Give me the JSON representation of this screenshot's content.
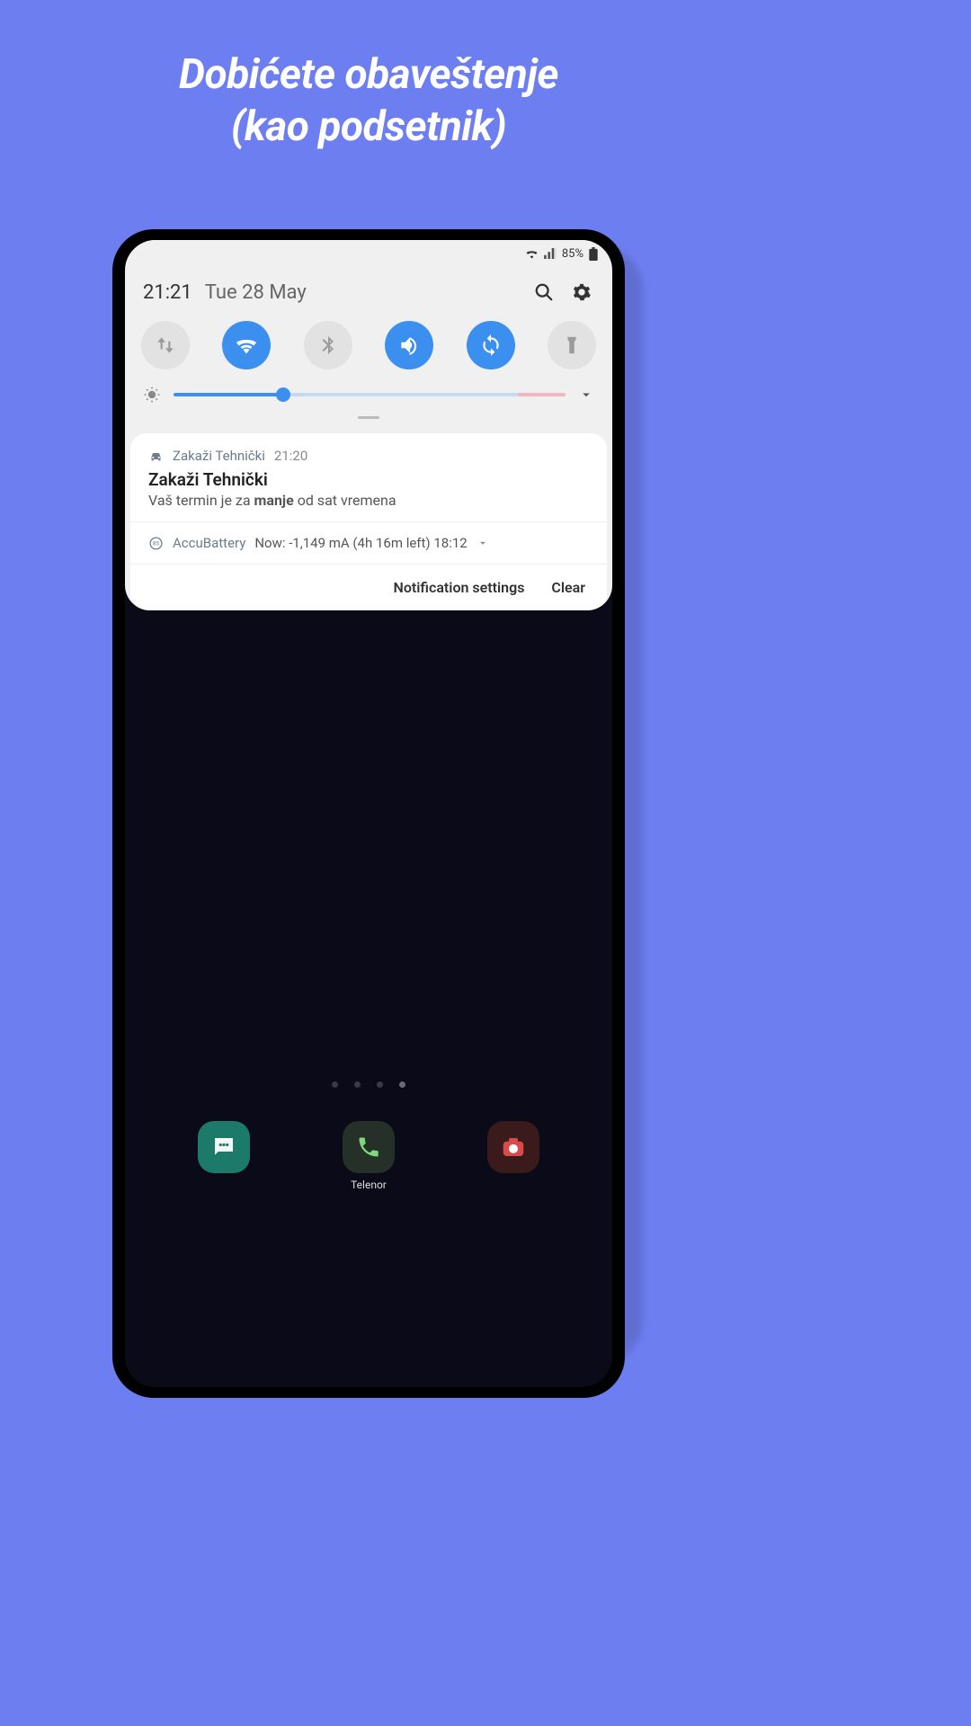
{
  "headline_line1": "Dobićete obaveštenje",
  "headline_line2": "(kao podsetnik)",
  "status": {
    "battery_text": "85%"
  },
  "qs": {
    "time": "21:21",
    "date": "Tue 28 May"
  },
  "notification1": {
    "app_name": "Zakaži Tehnički",
    "time": "21:20",
    "title": "Zakaži Tehnički",
    "body_prefix": "Vaš termin je za ",
    "body_bold": "manje",
    "body_suffix": " od sat vremena"
  },
  "notification2": {
    "app_name": "AccuBattery",
    "details": "Now: -1,149 mA (4h 16m left) 18:12"
  },
  "actions": {
    "settings": "Notification settings",
    "clear": "Clear"
  },
  "dock": {
    "phone_label": "Telenor"
  }
}
